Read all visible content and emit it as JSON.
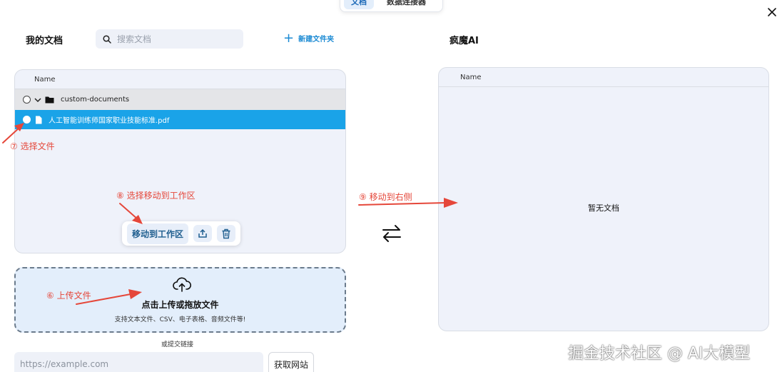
{
  "top_tabs": [
    {
      "label": "文档",
      "active": true
    },
    {
      "label": "数据连接器",
      "active": false
    }
  ],
  "left": {
    "title": "我的文档",
    "search_placeholder": "搜索文档",
    "new_folder_label": "新建文件夹",
    "column_name": "Name",
    "folder_name": "custom-documents",
    "file_name": "人工智能训练师国家职业技能标准.pdf",
    "actions": {
      "move_label": "移动到工作区"
    }
  },
  "upload": {
    "title": "点击上传或拖放文件",
    "subtitle": "支持文本文件、CSV、电子表格、音频文件等!",
    "or_link": "或提交链接",
    "url_placeholder": "https://example.com",
    "fetch_label": "获取网站"
  },
  "right": {
    "title": "疯魔AI",
    "column_name": "Name",
    "empty_text": "暂无文档"
  },
  "annotations": {
    "select_file": "⑦ 选择文件",
    "select_move": "⑧ 选择移动到工作区",
    "move_right": "⑨ 移动到右侧",
    "upload_file": "⑥ 上传文件"
  },
  "watermark": "掘金技术社区 @ AI大模型",
  "colors": {
    "accent": "#1b8ad3",
    "selected_row": "#1aa3e8",
    "annotation": "#e5473a",
    "panel_bg": "#eff2fa"
  }
}
